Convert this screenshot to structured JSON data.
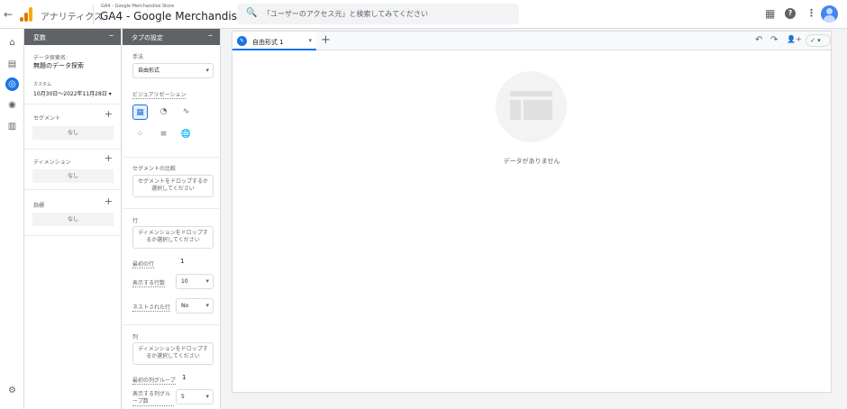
{
  "topbar": {
    "back": "←",
    "brand": "アナリティクス",
    "account": "GA4 - Google Merchandise Store",
    "property": "GA4 - Google Merchandise ...",
    "search_placeholder": "「ユーザーのアクセス元」と検索してみてください",
    "search_icon": "🔍"
  },
  "variables": {
    "header": "変数",
    "minimize": "–",
    "exploration_name_label": "データ探索名:",
    "exploration_name": "無題のデータ探索",
    "date_custom": "カスタム",
    "date_range": "10月30日～2022年11月28日",
    "segments_label": "セグメント",
    "dimensions_label": "ディメンション",
    "metrics_label": "指標",
    "none": "なし",
    "plus": "+"
  },
  "tab_settings": {
    "header": "タブの設定",
    "minimize": "–",
    "technique_label": "手法",
    "technique": "自由形式",
    "visualization_label": "ビジュアリゼーション",
    "segment_compare_label": "セグメントの比較",
    "segment_drop": "セグメントをドロップするか選択してください",
    "rows_label": "行",
    "rows_drop": "ディメンションをドロップするか選択してください",
    "first_row_label": "最初の行",
    "first_row": "1",
    "rows_shown_label": "表示する行数",
    "rows_shown": "10",
    "nested_rows_label": "ネストされた行",
    "nested_rows": "No",
    "columns_label": "列",
    "columns_drop": "ディメンションをドロップするか選択してください",
    "first_col_group_label": "最初の列グループ",
    "first_col_group": "1",
    "col_groups_shown_label": "表示する列グループ数",
    "col_groups_shown": "5"
  },
  "canvas": {
    "tab_name": "自由形式 1",
    "tab_dropdown": "▾",
    "add_tab": "+",
    "undo": "↶",
    "redo": "↷",
    "share": "👤+",
    "status": "✓ ▾",
    "no_data": "データがありません"
  },
  "colors": {
    "accent": "#1a73e8",
    "header_gray": "#5f6368",
    "logo": [
      "#f9ab00",
      "#e37400",
      "#e37400"
    ]
  }
}
